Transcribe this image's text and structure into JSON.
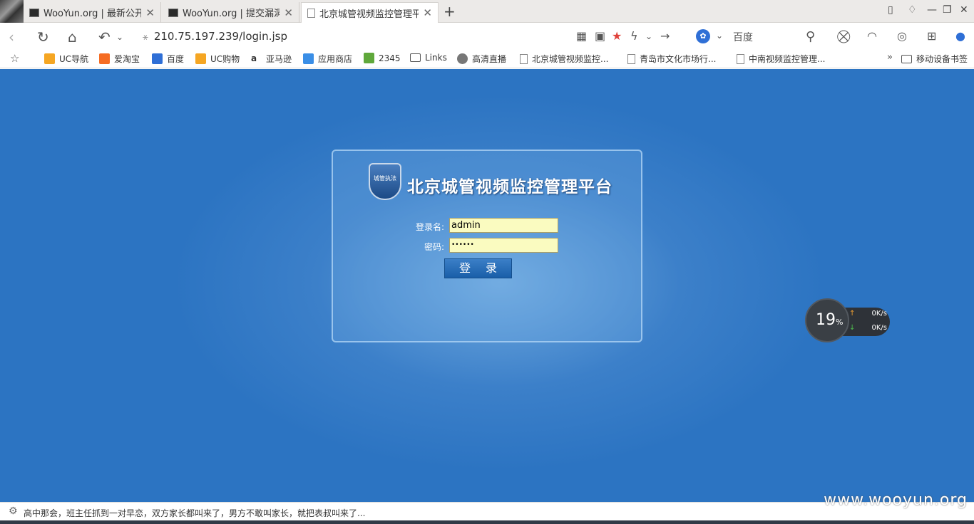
{
  "browser": {
    "tabs": [
      {
        "title": "WooYun.org | 最新公开",
        "active": false
      },
      {
        "title": "WooYun.org | 提交漏洞",
        "active": false
      },
      {
        "title": "北京城管视频监控管理平",
        "active": true
      }
    ],
    "url": "210.75.197.239/login.jsp",
    "search_placeholder": "百度",
    "bookmarks": [
      {
        "label": "UC导航",
        "icon": "uc-icon",
        "color": "#f5a623"
      },
      {
        "label": "爱淘宝",
        "icon": "taobao-icon",
        "color": "#f56c23"
      },
      {
        "label": "百度",
        "icon": "baidu-icon",
        "color": "#2f6fd6"
      },
      {
        "label": "UC购物",
        "icon": "uc-shop-icon",
        "color": "#f5a623"
      },
      {
        "label": "亚马逊",
        "icon": "amazon-icon",
        "color": "#333333"
      },
      {
        "label": "应用商店",
        "icon": "app-store-icon",
        "color": "#3a8ee6"
      },
      {
        "label": "2345",
        "icon": "2345-icon",
        "color": "#5fa83b"
      },
      {
        "label": "Links",
        "icon": "folder-icon",
        "color": "#ffffff"
      },
      {
        "label": "高清直播",
        "icon": "live-icon",
        "color": "#777777"
      },
      {
        "label": "北京城管视频监控...",
        "icon": "page-icon",
        "color": "#ffffff"
      },
      {
        "label": "青岛市文化市场行...",
        "icon": "page-icon",
        "color": "#ffffff"
      },
      {
        "label": "中南视频监控管理...",
        "icon": "page-icon",
        "color": "#ffffff"
      }
    ],
    "bookmarks_overflow": "»",
    "mobile_bookmarks": "移动设备书签"
  },
  "login": {
    "badge_text": "城管执法",
    "title": "北京城管视频监控管理平台",
    "username_label": "登录名:",
    "username_value": "admin",
    "password_label": "密码:",
    "password_value": "••••••",
    "submit_label": "登 录"
  },
  "speed_widget": {
    "percent": "19",
    "percent_unit": "%",
    "upload": "0K/s",
    "download": "0K/s"
  },
  "status": {
    "news_text": "高中那会，班主任抓到一对早恋，双方家长都叫来了，男方不敢叫家长，就把表叔叫来了..."
  },
  "watermark": "www.wooyun.org"
}
